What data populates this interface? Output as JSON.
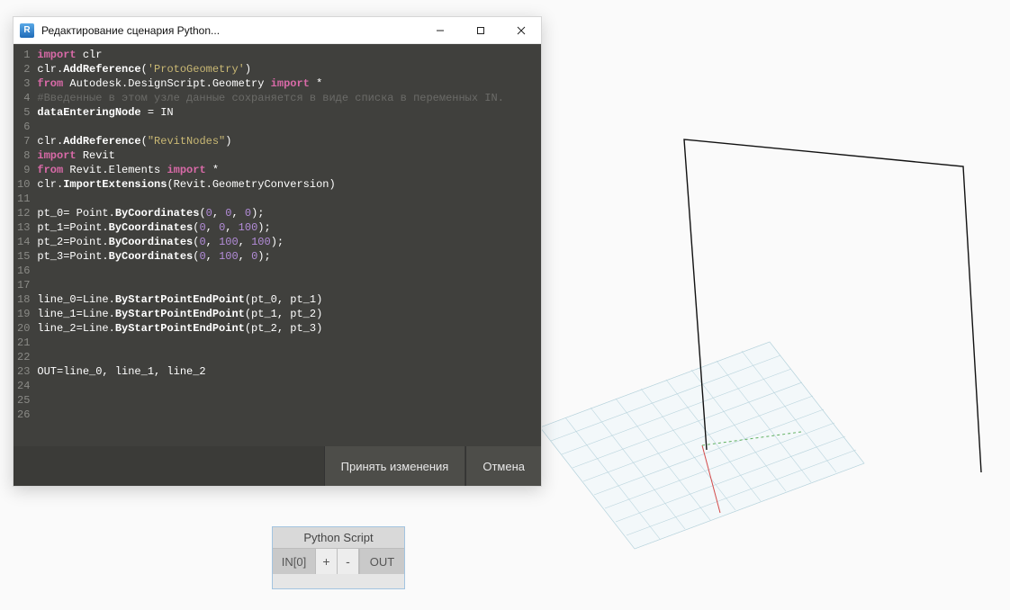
{
  "window": {
    "title": "Редактирование сценария Python...",
    "app_icon_letter": "R"
  },
  "code": {
    "lines": [
      [
        [
          "kw",
          "import"
        ],
        [
          "sp",
          " "
        ],
        [
          "mod",
          "clr"
        ]
      ],
      [
        [
          "var",
          "clr."
        ],
        [
          "fn",
          "AddReference"
        ],
        [
          "var",
          "("
        ],
        [
          "str",
          "'ProtoGeometry'"
        ],
        [
          "var",
          ")"
        ]
      ],
      [
        [
          "kw",
          "from"
        ],
        [
          "sp",
          " "
        ],
        [
          "mod",
          "Autodesk.DesignScript.Geometry"
        ],
        [
          "sp",
          " "
        ],
        [
          "kw",
          "import"
        ],
        [
          "sp",
          " "
        ],
        [
          "star",
          "*"
        ]
      ],
      [
        [
          "cmt",
          "#Введенные в этом узле данные сохраняется в виде списка в переменных IN."
        ]
      ],
      [
        [
          "fn",
          "dataEnteringNode"
        ],
        [
          "var",
          " = IN"
        ]
      ],
      [],
      [
        [
          "var",
          "clr."
        ],
        [
          "fn",
          "AddReference"
        ],
        [
          "var",
          "("
        ],
        [
          "str",
          "\"RevitNodes\""
        ],
        [
          "var",
          ")"
        ]
      ],
      [
        [
          "kw",
          "import"
        ],
        [
          "sp",
          " "
        ],
        [
          "mod",
          "Revit"
        ]
      ],
      [
        [
          "kw",
          "from"
        ],
        [
          "sp",
          " "
        ],
        [
          "mod",
          "Revit.Elements"
        ],
        [
          "sp",
          " "
        ],
        [
          "kw",
          "import"
        ],
        [
          "sp",
          " "
        ],
        [
          "star",
          "*"
        ]
      ],
      [
        [
          "var",
          "clr."
        ],
        [
          "fn",
          "ImportExtensions"
        ],
        [
          "var",
          "(Revit.GeometryConversion)"
        ]
      ],
      [],
      [
        [
          "var",
          "pt_0= Point."
        ],
        [
          "fn",
          "ByCoordinates"
        ],
        [
          "var",
          "("
        ],
        [
          "num",
          "0"
        ],
        [
          "var",
          ", "
        ],
        [
          "num",
          "0"
        ],
        [
          "var",
          ", "
        ],
        [
          "num",
          "0"
        ],
        [
          "var",
          ");"
        ]
      ],
      [
        [
          "var",
          "pt_1=Point."
        ],
        [
          "fn",
          "ByCoordinates"
        ],
        [
          "var",
          "("
        ],
        [
          "num",
          "0"
        ],
        [
          "var",
          ", "
        ],
        [
          "num",
          "0"
        ],
        [
          "var",
          ", "
        ],
        [
          "num",
          "100"
        ],
        [
          "var",
          ");"
        ]
      ],
      [
        [
          "var",
          "pt_2=Point."
        ],
        [
          "fn",
          "ByCoordinates"
        ],
        [
          "var",
          "("
        ],
        [
          "num",
          "0"
        ],
        [
          "var",
          ", "
        ],
        [
          "num",
          "100"
        ],
        [
          "var",
          ", "
        ],
        [
          "num",
          "100"
        ],
        [
          "var",
          ");"
        ]
      ],
      [
        [
          "var",
          "pt_3=Point."
        ],
        [
          "fn",
          "ByCoordinates"
        ],
        [
          "var",
          "("
        ],
        [
          "num",
          "0"
        ],
        [
          "var",
          ", "
        ],
        [
          "num",
          "100"
        ],
        [
          "var",
          ", "
        ],
        [
          "num",
          "0"
        ],
        [
          "var",
          ");"
        ]
      ],
      [],
      [],
      [
        [
          "var",
          "line_0=Line."
        ],
        [
          "fn",
          "ByStartPointEndPoint"
        ],
        [
          "var",
          "(pt_0, pt_1)"
        ]
      ],
      [
        [
          "var",
          "line_1=Line."
        ],
        [
          "fn",
          "ByStartPointEndPoint"
        ],
        [
          "var",
          "(pt_1, pt_2)"
        ]
      ],
      [
        [
          "var",
          "line_2=Line."
        ],
        [
          "fn",
          "ByStartPointEndPoint"
        ],
        [
          "var",
          "(pt_2, pt_3)"
        ]
      ],
      [],
      [],
      [
        [
          "var",
          "OUT=line_0, line_1, line_2"
        ]
      ],
      [],
      [],
      []
    ]
  },
  "footer": {
    "accept": "Принять изменения",
    "cancel": "Отмена"
  },
  "node": {
    "title": "Python Script",
    "in_port": "IN[0]",
    "plus": "+",
    "minus": "-",
    "out_port": "OUT"
  }
}
